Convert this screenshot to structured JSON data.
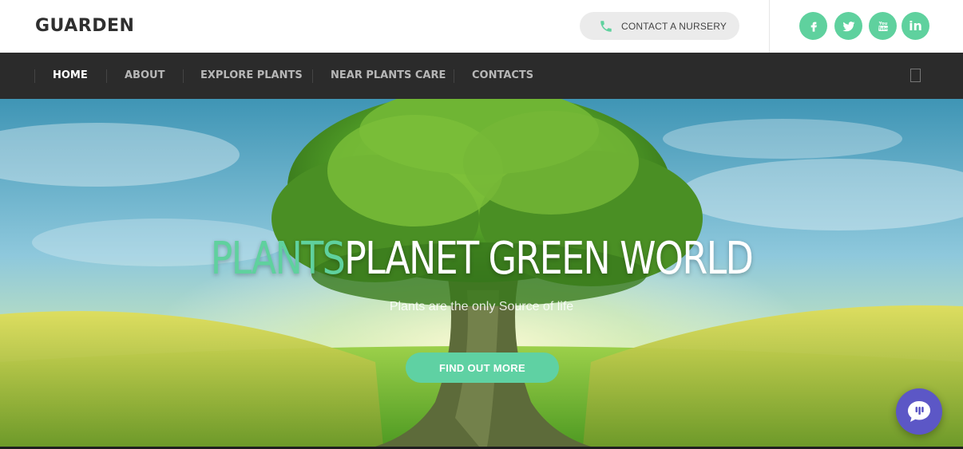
{
  "brand": {
    "logo_text": "GUARDEN"
  },
  "header": {
    "contact_label": "CONTACT A NURSERY",
    "social": [
      {
        "name": "facebook",
        "glyph": "f"
      },
      {
        "name": "twitter",
        "glyph": ""
      },
      {
        "name": "youtube",
        "glyph": "You"
      },
      {
        "name": "linkedin",
        "glyph": "in"
      }
    ],
    "accent_color": "#5fd19e"
  },
  "nav": {
    "items": [
      {
        "label": "HOME",
        "active": true
      },
      {
        "label": "ABOUT",
        "active": false
      },
      {
        "label": "EXPLORE PLANTS",
        "active": false
      },
      {
        "label": "NEAR PLANTS CARE",
        "active": false
      },
      {
        "label": "CONTACTS",
        "active": false
      }
    ]
  },
  "hero": {
    "title_accent": "PLANTS",
    "title_rest": "PLANET GREEN WORLD",
    "subtitle": "Plants are the only Source of life",
    "cta_label": "FIND OUT MORE"
  },
  "icons": {
    "contact": "phone-icon",
    "chat": "chat-bubble-icon",
    "menu": "square-icon"
  }
}
